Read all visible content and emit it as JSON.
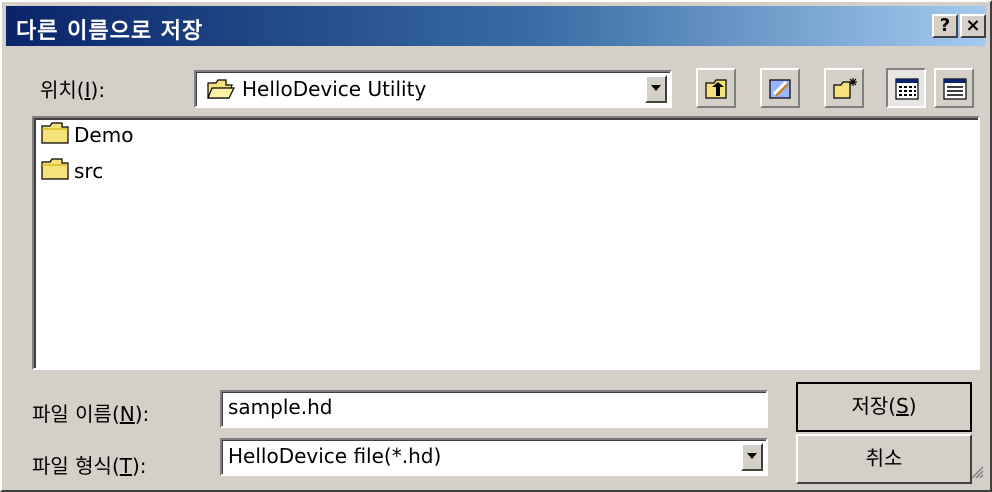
{
  "window": {
    "title": "다른 이름으로 저장",
    "help_button": "?",
    "close_button": "×"
  },
  "location": {
    "label_prefix": "위치(",
    "label_mnemonic": "I",
    "label_suffix": "):",
    "value": "HelloDevice Utility"
  },
  "toolbar": {
    "icons": [
      "up-one-level-icon",
      "desktop-icon",
      "new-folder-icon",
      "list-view-icon",
      "details-view-icon"
    ]
  },
  "files": [
    {
      "name": "Demo",
      "icon": "folder-icon"
    },
    {
      "name": "src",
      "icon": "folder-icon"
    }
  ],
  "filename": {
    "label_prefix": "파일 이름(",
    "label_mnemonic": "N",
    "label_suffix": "):",
    "value": "sample.hd"
  },
  "filetype": {
    "label_prefix": "파일 형식(",
    "label_mnemonic": "T",
    "label_suffix": "):",
    "value": "HelloDevice file(*.hd)"
  },
  "buttons": {
    "save_prefix": "저장(",
    "save_mnemonic": "S",
    "save_suffix": ")",
    "cancel": "취소"
  },
  "colors": {
    "title_gradient_start": "#0a246a",
    "title_gradient_end": "#a6caf0",
    "face": "#d4d0c8"
  }
}
